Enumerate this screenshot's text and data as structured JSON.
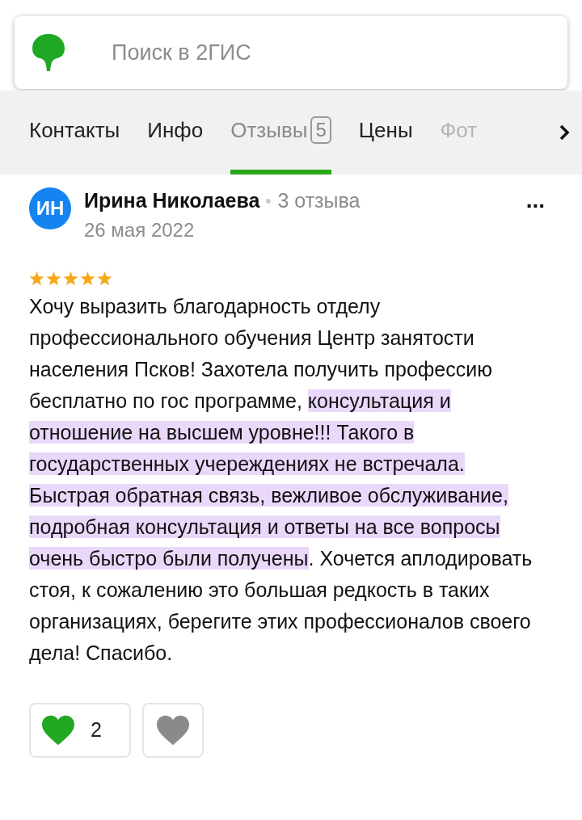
{
  "search": {
    "placeholder": "Поиск в 2ГИС"
  },
  "tabs": [
    {
      "label": "Контакты",
      "selected": false,
      "faded": false
    },
    {
      "label": "Инфо",
      "selected": false,
      "faded": false
    },
    {
      "label": "Отзывы",
      "count": "5",
      "selected": true,
      "faded": false
    },
    {
      "label": "Цены",
      "selected": false,
      "faded": false
    },
    {
      "label": "Фот",
      "selected": false,
      "faded": true
    }
  ],
  "review": {
    "initials": "ИН",
    "author": "Ирина Николаева",
    "author_reviews": "3 отзыва",
    "date": "26 мая 2022",
    "menu": "...",
    "stars": 5,
    "segments": [
      {
        "text": "Хочу выразить благодарность отделу профессионального обучения Центр занятости населения Псков! Захотела получить профессию бесплатно по гос программе, ",
        "highlighted": false
      },
      {
        "text": "консультация и отношение на высшем уровне!!! Такого в государственных учереждениях не встречала. Быстрая обратная связь, вежливое обслуживание, подробная консультация и ответы на все вопросы очень быстро были получены",
        "highlighted": true
      },
      {
        "text": ". Хочется аплодировать стоя, к сожалению это большая редкость в таких организациях, берегите этих профессионалов своего дела! Спасибо.",
        "highlighted": false
      }
    ],
    "like": {
      "count": "2",
      "selected": true
    },
    "dislike": {
      "selected": false
    }
  }
}
